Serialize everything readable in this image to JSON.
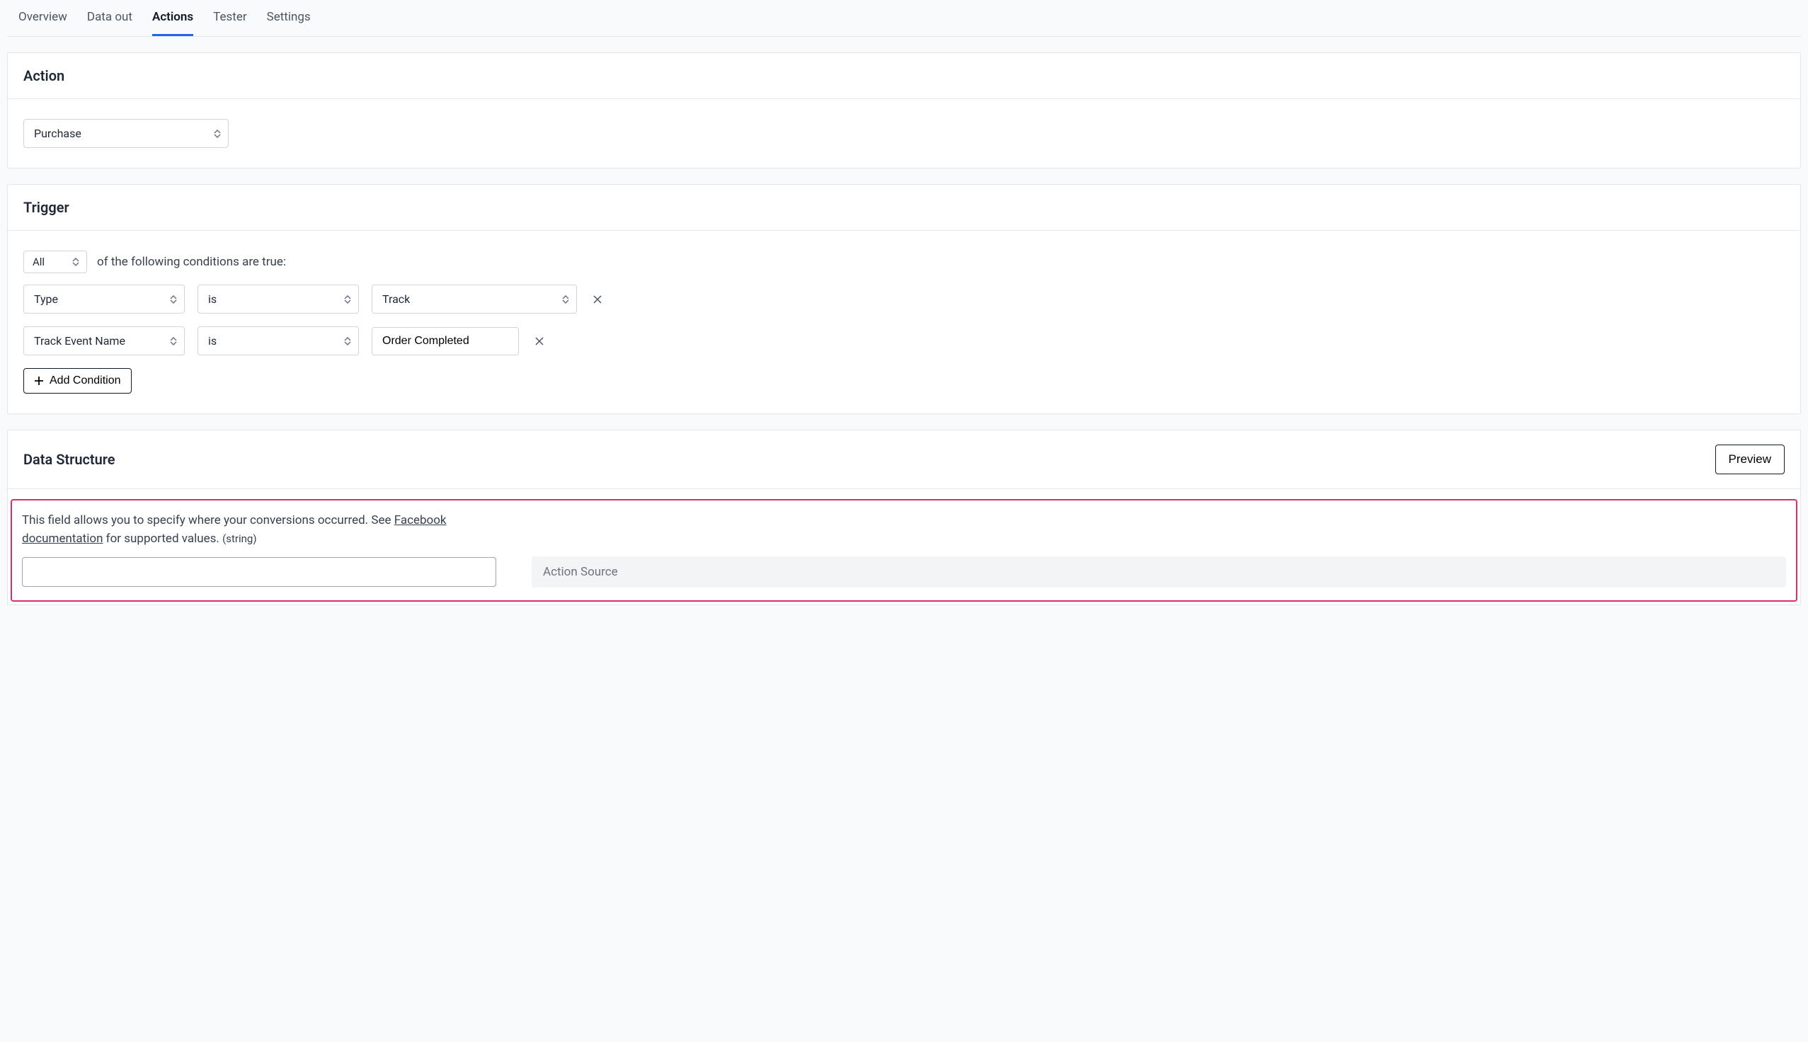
{
  "tabs": {
    "items": [
      {
        "label": "Overview",
        "active": false
      },
      {
        "label": "Data out",
        "active": false
      },
      {
        "label": "Actions",
        "active": true
      },
      {
        "label": "Tester",
        "active": false
      },
      {
        "label": "Settings",
        "active": false
      }
    ]
  },
  "action": {
    "heading": "Action",
    "select_value": "Purchase"
  },
  "trigger": {
    "heading": "Trigger",
    "quantifier": "All",
    "quantifier_suffix": "of the following conditions are true:",
    "conditions": [
      {
        "field": "Type",
        "operator": "is",
        "value": "Track",
        "value_is_select": true
      },
      {
        "field": "Track Event Name",
        "operator": "is",
        "value": "Order Completed",
        "value_is_select": false
      }
    ],
    "add_button": "Add Condition"
  },
  "data_structure": {
    "heading": "Data Structure",
    "preview_button": "Preview",
    "help_pre": "This field allows you to specify where your conversions occurred. See ",
    "help_link": "Facebook documentation",
    "help_post": " for supported values. ",
    "type_hint": "(string)",
    "input_value": "",
    "readonly_label": "Action Source"
  }
}
